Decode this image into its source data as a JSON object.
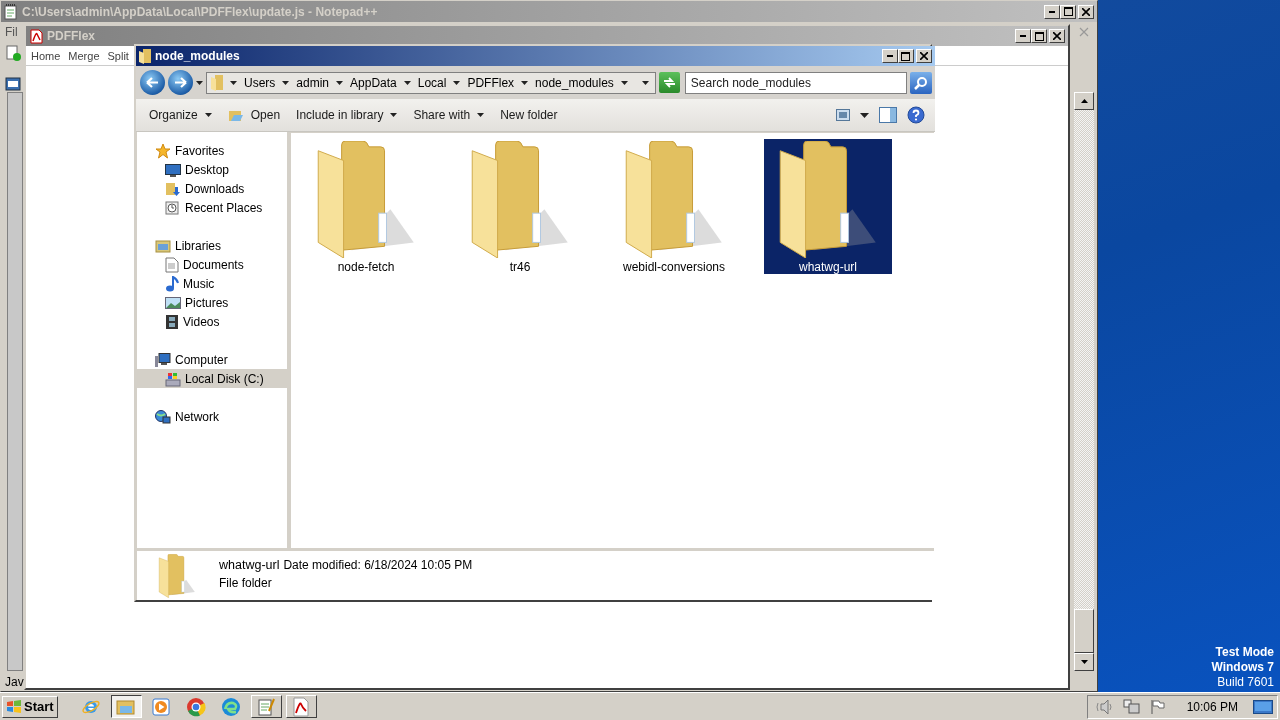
{
  "notepad_window": {
    "title": "C:\\Users\\admin\\AppData\\Local\\PDFFlex\\update.js - Notepad++",
    "active": false,
    "menu_fragment": "Fil",
    "status_fragment": "Jav"
  },
  "pdf_window": {
    "title": "PDFFlex",
    "active": false,
    "menu": [
      "Home",
      "Merge",
      "Split"
    ]
  },
  "explorer_window": {
    "title": "node_modules",
    "active": true,
    "breadcrumb": [
      "Users",
      "admin",
      "AppData",
      "Local",
      "PDFFlex",
      "node_modules"
    ],
    "search": {
      "placeholder": "Search node_modules"
    },
    "toolbar": [
      {
        "label": "Organize",
        "kind": "menu"
      },
      {
        "label": "Open",
        "kind": "icon"
      },
      {
        "label": "Include in library",
        "kind": "menu"
      },
      {
        "label": "Share with",
        "kind": "menu"
      },
      {
        "label": "New folder",
        "kind": "plain"
      }
    ],
    "nav": [
      {
        "label": "Favorites",
        "selected": false,
        "children": [
          {
            "label": "Desktop",
            "selected": false
          },
          {
            "label": "Downloads",
            "selected": false
          },
          {
            "label": "Recent Places",
            "selected": false
          }
        ]
      },
      {
        "label": "Libraries",
        "selected": false,
        "children": [
          {
            "label": "Documents",
            "selected": false
          },
          {
            "label": "Music",
            "selected": false
          },
          {
            "label": "Pictures",
            "selected": false
          },
          {
            "label": "Videos",
            "selected": false
          }
        ]
      },
      {
        "label": "Computer",
        "selected": false,
        "children": [
          {
            "label": "Local Disk (C:)",
            "selected": true
          }
        ]
      },
      {
        "label": "Network",
        "selected": false
      }
    ],
    "files": [
      {
        "name": "node-fetch",
        "selected": false
      },
      {
        "name": "tr46",
        "selected": false
      },
      {
        "name": "webidl-conversions",
        "selected": false
      },
      {
        "name": "whatwg-url",
        "selected": true
      }
    ],
    "details": {
      "name": "whatwg-url",
      "date_modified": "Date modified: 6/18/2024 10:05 PM",
      "type": "File folder"
    }
  },
  "taskbar": {
    "start": "Start",
    "items": [
      {
        "open": false,
        "selected": false
      },
      {
        "open": true,
        "selected": true
      },
      {
        "open": false,
        "selected": false
      },
      {
        "open": false,
        "selected": false
      },
      {
        "open": false,
        "selected": false
      },
      {
        "open": true,
        "selected": false
      },
      {
        "open": true,
        "selected": false
      }
    ],
    "clock": "10:06 PM"
  },
  "desktop": {
    "notice": [
      "Test Mode",
      "Windows 7",
      "Build 7601"
    ]
  }
}
